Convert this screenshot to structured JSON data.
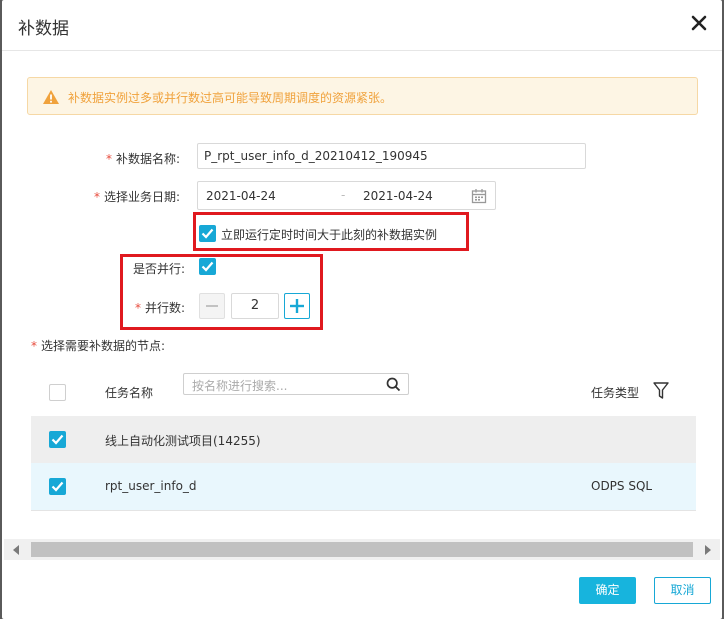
{
  "dialog": {
    "title": "补数据"
  },
  "warning": {
    "text": "补数据实例过多或并行数过高可能导致周期调度的资源紧张。"
  },
  "form": {
    "required_mark": "*",
    "name_label": "补数据名称:",
    "name_value": "P_rpt_user_info_d_20210412_190945",
    "date_label": "选择业务日期:",
    "date_start": "2021-04-24",
    "date_sep": "-",
    "date_end": "2021-04-24",
    "run_now_label": "立即运行定时时间大于此刻的补数据实例",
    "run_now_checked": true,
    "parallel_label": "是否并行:",
    "parallel_checked": true,
    "parallel_count_label": "并行数:",
    "parallel_count": "2",
    "nodes_label": "选择需要补数据的节点:"
  },
  "table": {
    "col_task_name": "任务名称",
    "search_placeholder": "按名称进行搜索...",
    "col_task_type": "任务类型",
    "rows": [
      {
        "name": "线上自动化测试项目(14255)",
        "type": "",
        "checked": true
      },
      {
        "name": "rpt_user_info_d",
        "type": "ODPS SQL",
        "checked": true
      }
    ]
  },
  "buttons": {
    "ok": "确定",
    "cancel": "取消"
  },
  "colors": {
    "accent": "#17a8d6",
    "warning_text": "#f0a23c",
    "annotation": "#e0191f"
  }
}
